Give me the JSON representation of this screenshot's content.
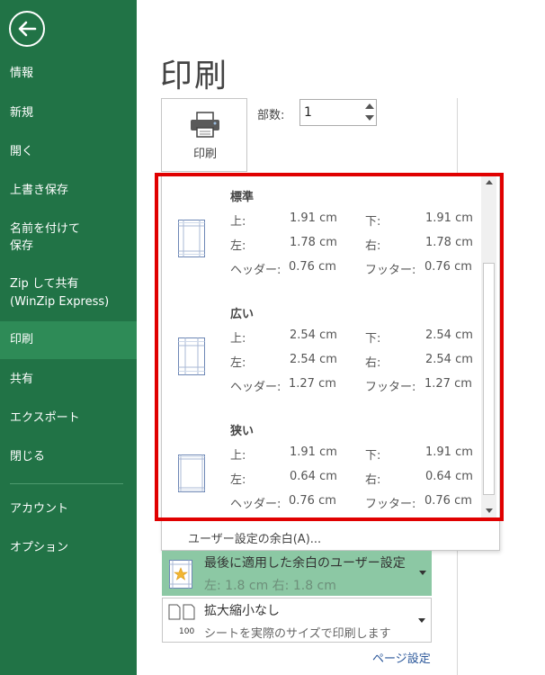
{
  "sidebar": {
    "items": [
      {
        "label": "情報"
      },
      {
        "label": "新規"
      },
      {
        "label": "開く"
      },
      {
        "label": "上書き保存"
      },
      {
        "label": "名前を付けて\n保存"
      },
      {
        "label": "Zip して共有\n(WinZip Express)"
      },
      {
        "label": "印刷",
        "selected": true
      },
      {
        "label": "共有"
      },
      {
        "label": "エクスポート"
      },
      {
        "label": "閉じる"
      },
      {
        "label": "アカウント"
      },
      {
        "label": "オプション"
      }
    ]
  },
  "main": {
    "title": "印刷",
    "print_button_label": "印刷",
    "copies_label": "部数:",
    "copies_value": "1"
  },
  "margins": {
    "options": [
      {
        "name": "標準",
        "top_label": "上:",
        "top": "1.91 cm",
        "bottom_label": "下:",
        "bottom": "1.91 cm",
        "left_label": "左:",
        "left": "1.78 cm",
        "right_label": "右:",
        "right": "1.78 cm",
        "header_label": "ヘッダー:",
        "header": "0.76 cm",
        "footer_label": "フッター:",
        "footer": "0.76 cm"
      },
      {
        "name": "広い",
        "top_label": "上:",
        "top": "2.54 cm",
        "bottom_label": "下:",
        "bottom": "2.54 cm",
        "left_label": "左:",
        "left": "2.54 cm",
        "right_label": "右:",
        "right": "2.54 cm",
        "header_label": "ヘッダー:",
        "header": "1.27 cm",
        "footer_label": "フッター:",
        "footer": "1.27 cm"
      },
      {
        "name": "狭い",
        "top_label": "上:",
        "top": "1.91 cm",
        "bottom_label": "下:",
        "bottom": "1.91 cm",
        "left_label": "左:",
        "left": "0.64 cm",
        "right_label": "右:",
        "right": "0.64 cm",
        "header_label": "ヘッダー:",
        "header": "0.76 cm",
        "footer_label": "フッター:",
        "footer": "0.76 cm"
      }
    ],
    "custom_label": "ユーザー設定の余白(A)..."
  },
  "last_custom": {
    "title": "最後に適用した余白のユーザー設定",
    "detail": "左:  1.8 cm    右:  1.8 cm"
  },
  "scaling": {
    "title": "拡大縮小なし",
    "description": "シートを実際のサイズで印刷します",
    "icon_number": "100"
  },
  "page_setup_link": "ページ設定",
  "colors": {
    "sidebar": "#217346",
    "selected": "#2e8b57",
    "highlight_frame": "#e00000",
    "last_custom_bg": "#8cc8a4",
    "link": "#2b579a"
  },
  "icons": [
    "back-arrow-icon",
    "printer-icon",
    "page-margin-icon",
    "star-icon",
    "scale-pages-icon"
  ]
}
